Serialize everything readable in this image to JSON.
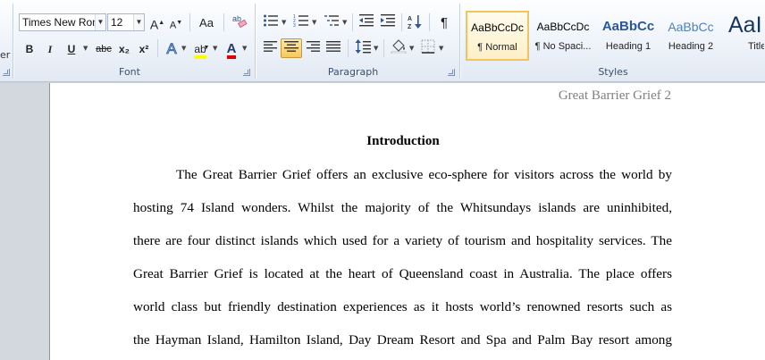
{
  "ribbon": {
    "clipboard_fragment": "er",
    "font": {
      "group_label": "Font",
      "font_name": "Times New Rom",
      "font_size": "12",
      "grow_font": "A",
      "shrink_font": "A",
      "change_case": "Aa",
      "bold": "B",
      "italic": "I",
      "underline": "U",
      "strikethrough": "abc",
      "subscript": "x₂",
      "superscript": "x²",
      "text_effects": "A",
      "highlight": "ab",
      "font_color": "A"
    },
    "paragraph": {
      "group_label": "Paragraph",
      "show_marks": "¶"
    },
    "styles": {
      "group_label": "Styles",
      "items": [
        {
          "sample": "AaBbCcDc",
          "name": "¶ Normal"
        },
        {
          "sample": "AaBbCcDc",
          "name": "¶ No Spaci..."
        },
        {
          "sample": "AaBbCc",
          "name": "Heading 1"
        },
        {
          "sample": "AaBbCc",
          "name": "Heading 2"
        },
        {
          "sample": "AaI",
          "name": "Title"
        }
      ]
    },
    "colors": {
      "selected_style_border": "#f2c55c",
      "heading_blue": "#2b5797",
      "highlight_yellow": "#ffff00",
      "font_red": "#e00000"
    }
  },
  "document": {
    "header": "Great Barrier Grief 2",
    "heading": "Introduction",
    "lines": [
      "The Great Barrier Grief offers an exclusive eco-sphere for visitors across the world by",
      "hosting 74 Island wonders. Whilst the majority of the Whitsundays islands are uninhibited,",
      "there are four distinct islands which used for a variety of tourism and hospitality services. The",
      "Great Barrier Grief is located at the heart of Queensland coast in Australia. The place offers",
      "world class but friendly destination experiences as it hosts world’s renowned resorts such as",
      "the Hayman Island, Hamilton Island, Day Dream Resort and Spa and Palm Bay resort among"
    ]
  }
}
